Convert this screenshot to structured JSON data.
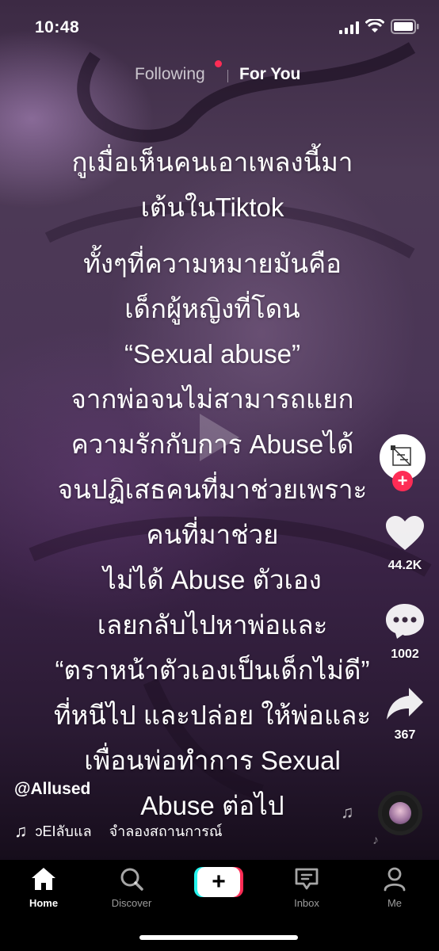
{
  "status_bar": {
    "time": "10:48"
  },
  "feed_tabs": {
    "following": "Following",
    "for_you": "For You"
  },
  "caption": {
    "lines_top": [
      "กูเมื่อเห็นคนเอาเพลงนี้มา",
      "เต้นในTiktok"
    ],
    "lines_body": [
      "ทั้งๆที่ความหมายมันคือ",
      "เด็กผู้หญิงที่โดน",
      "“Sexual abuse”",
      "จากพ่อจนไม่สามารถแยก",
      "ความรักกับการ Abuseได้",
      "จนปฏิเสธคนที่มาช่วยเพราะ",
      "คนที่มาช่วย",
      "ไม่ได้ Abuse ตัวเอง",
      "เลยกลับไปหาพ่อและ",
      "“ตราหน้าตัวเองเป็นเด็กไม่ดี”",
      "ที่หนีไป และปล่อย ให้พ่อและ",
      "เพื่อนพ่อทำการ Sexual",
      "Abuse ต่อไป"
    ]
  },
  "actions": {
    "likes": "44.2K",
    "comments": "1002",
    "shares": "367"
  },
  "author": {
    "handle": "@Allused"
  },
  "music": {
    "text_1": "ↄEIลับแล",
    "text_2": "จำลองสถานการณ์"
  },
  "nav": {
    "home": "Home",
    "discover": "Discover",
    "inbox": "Inbox",
    "me": "Me"
  },
  "colors": {
    "accent_red": "#fe2c55",
    "accent_cyan": "#25f4ee"
  }
}
